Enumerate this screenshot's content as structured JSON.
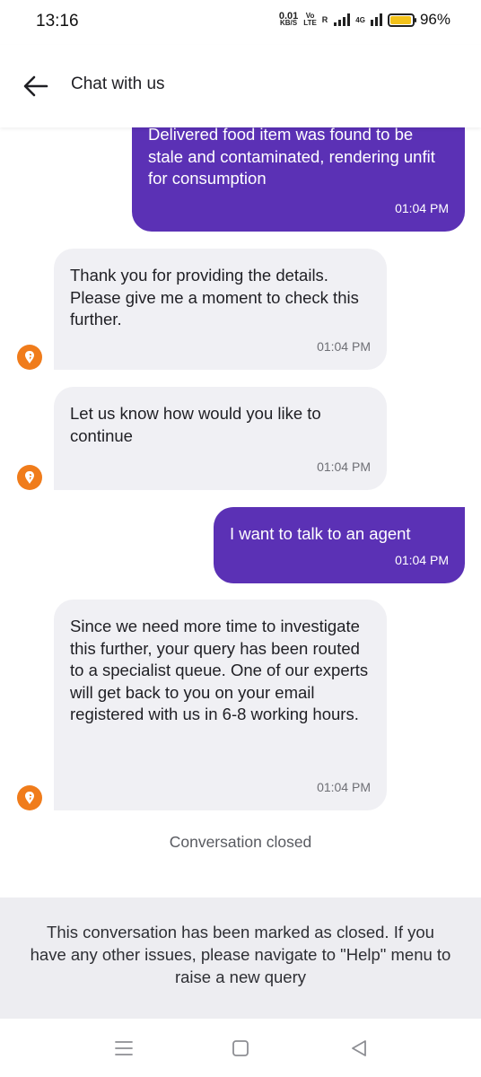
{
  "status_bar": {
    "time": "13:16",
    "net_speed_value": "0.01",
    "net_speed_unit": "KB/S",
    "volte_top": "Vo",
    "volte_bottom": "LTE",
    "sim_label": "R",
    "network_type": "4G",
    "battery_percent": "96%",
    "battery_level": 0.96
  },
  "header": {
    "title": "Chat with us",
    "back_icon": "arrow-left-icon"
  },
  "messages": [
    {
      "sender": "user",
      "text": "Delivered food item was found to be stale and contaminated, rendering unfit for consumption",
      "time": "01:04 PM"
    },
    {
      "sender": "bot",
      "text": "Thank you for providing the details. Please give me a moment to check this further.",
      "time": "01:04 PM"
    },
    {
      "sender": "bot",
      "text": "Let us know how would you like to continue",
      "time": "01:04 PM"
    },
    {
      "sender": "user",
      "text": "I want to talk to an agent",
      "time": "01:04 PM"
    },
    {
      "sender": "bot",
      "text": "Since we need more time to investigate this further, your query has been routed to a specialist queue. One of our experts will get back to you on your email registered with us in 6-8 working hours.",
      "time": "01:04 PM"
    }
  ],
  "conversation_status": "Conversation closed",
  "closed_notice": "This conversation has been marked as closed. If you have any other issues, please navigate to \"Help\" menu to raise a new query",
  "colors": {
    "user_bubble": "#5b31b5",
    "bot_bubble": "#f0f0f4",
    "brand_avatar": "#f07c1b",
    "battery": "#f3c21a"
  },
  "nav_bar": {
    "menu_icon": "menu-icon",
    "home_icon": "square-home-icon",
    "back_icon": "triangle-back-icon"
  }
}
